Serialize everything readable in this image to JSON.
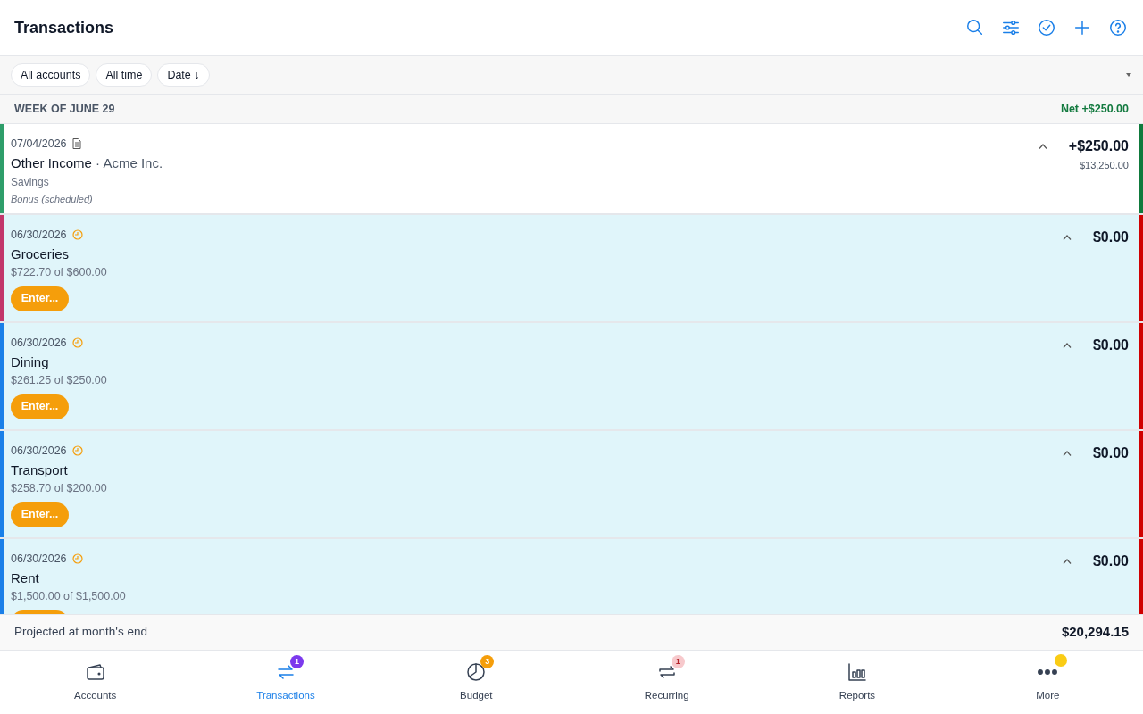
{
  "header": {
    "title": "Transactions",
    "actions": [
      {
        "kind": "search"
      },
      {
        "kind": "filter"
      },
      {
        "kind": "check"
      },
      {
        "kind": "add"
      },
      {
        "kind": "help"
      }
    ]
  },
  "filters": [
    {
      "label": "All accounts"
    },
    {
      "label": "All time"
    },
    {
      "label": "Date ↓"
    }
  ],
  "week": {
    "title": "WEEK OF JUNE 29",
    "net": "Net +$250.00"
  },
  "rows": [
    {
      "kind": "income",
      "color": "#2e9e6a",
      "date": "07/04/2026",
      "name": "Other Income",
      "separator": "·",
      "payee": "Acme Inc.",
      "account": "Savings",
      "memo": "Bonus (scheduled)",
      "amount": "+$250.00",
      "balance": "$13,250.00"
    },
    {
      "kind": "budget",
      "color": "#c2366b",
      "date": "06/30/2026",
      "name": "Groceries",
      "progress": "$722.70 of $600.00",
      "action": "Enter...",
      "amount": "$0.00"
    },
    {
      "kind": "budget",
      "color": "#1a7fe8",
      "date": "06/30/2026",
      "name": "Dining",
      "progress": "$261.25 of $250.00",
      "action": "Enter...",
      "amount": "$0.00"
    },
    {
      "kind": "budget",
      "color": "#1a7fe8",
      "date": "06/30/2026",
      "name": "Transport",
      "progress": "$258.70 of $200.00",
      "action": "Enter...",
      "amount": "$0.00"
    },
    {
      "kind": "budget",
      "color": "#1a7fe8",
      "date": "06/30/2026",
      "name": "Rent",
      "progress": "$1,500.00 of $1,500.00",
      "amount": "$0.00",
      "action_cut": true
    }
  ],
  "projection": {
    "label": "Projected at month's end",
    "value": "$20,294.15"
  },
  "nav": [
    {
      "kind": "wallet",
      "label": "Accounts",
      "selected": false
    },
    {
      "kind": "transfer",
      "label": "Transactions",
      "selected": true,
      "badge": {
        "text": "1",
        "color": "#7c3aed",
        "muted": false
      }
    },
    {
      "kind": "pie",
      "label": "Budget",
      "selected": false,
      "badge": {
        "text": "3",
        "color": "#f59e0b",
        "muted": false
      }
    },
    {
      "kind": "repeat",
      "label": "Recurring",
      "selected": false,
      "badge": {
        "text": "1",
        "color": "#f7c9cc",
        "muted": true
      }
    },
    {
      "kind": "chart",
      "label": "Reports",
      "selected": false
    },
    {
      "kind": "dots",
      "label": "More",
      "selected": false,
      "dot": {
        "color": "#facc15"
      }
    }
  ]
}
